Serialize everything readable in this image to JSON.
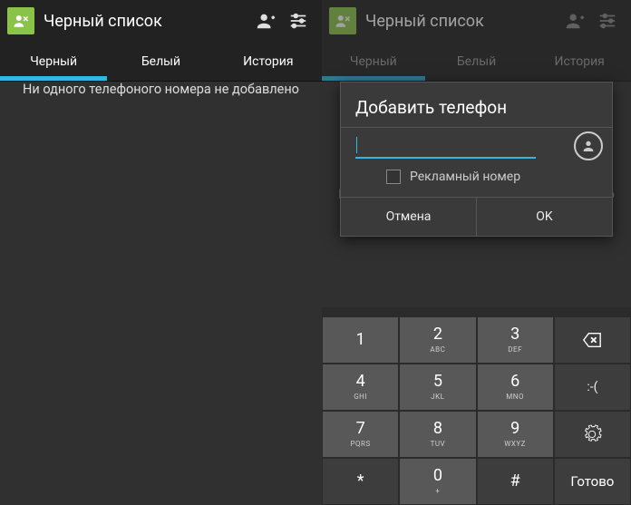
{
  "colors": {
    "accent": "#33b5e5",
    "app_icon_bg": "#8BC34A"
  },
  "header": {
    "title": "Черный список"
  },
  "tabs": [
    "Черный",
    "Белый",
    "История"
  ],
  "empty_message": "Ни одного телефоного номера не добавлено",
  "dialog": {
    "title": "Добавить телефон",
    "input_value": "",
    "checkbox_label": "Рекламный номер",
    "cancel": "Отмена",
    "ok": "OK"
  },
  "keypad": {
    "rows": [
      [
        {
          "main": "1",
          "sub": ""
        },
        {
          "main": "2",
          "sub": "ABC"
        },
        {
          "main": "3",
          "sub": "DEF"
        },
        {
          "icon": "backspace",
          "dark": true
        }
      ],
      [
        {
          "main": "4",
          "sub": "GHI"
        },
        {
          "main": "5",
          "sub": "JKL"
        },
        {
          "main": "6",
          "sub": "MNO"
        },
        {
          "text": ":-(",
          "dark": true
        }
      ],
      [
        {
          "main": "7",
          "sub": "PQRS"
        },
        {
          "main": "8",
          "sub": "TUV"
        },
        {
          "main": "9",
          "sub": "WXYZ"
        },
        {
          "icon": "gear",
          "dark": true
        }
      ],
      [
        {
          "main": "*",
          "dark": true
        },
        {
          "main": "0",
          "sub": "+"
        },
        {
          "main": "#",
          "dark": true
        },
        {
          "done": "Готово",
          "dark": true
        }
      ]
    ]
  }
}
